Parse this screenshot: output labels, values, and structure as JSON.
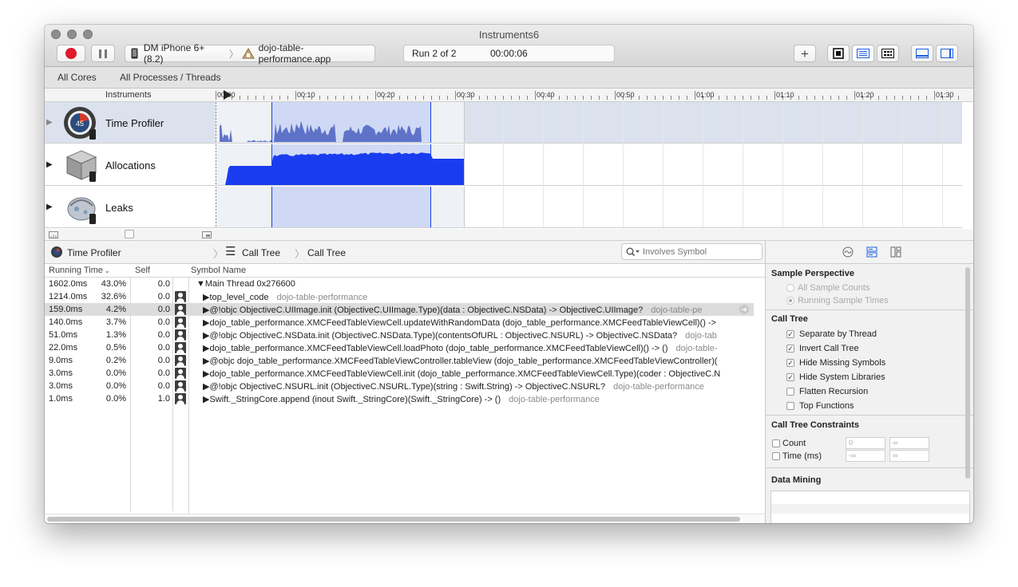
{
  "window": {
    "title": "Instruments6"
  },
  "toolbar": {
    "device": "DM iPhone 6+ (8.2)",
    "app": "dojo-table-performance.app",
    "run_label": "Run 2 of 2",
    "elapsed": "00:00:06"
  },
  "scope": {
    "cores": "All Cores",
    "processes": "All Processes / Threads"
  },
  "timeline": {
    "header": "Instruments",
    "ticks": [
      "00:00",
      "00:10",
      "00:20",
      "00:30",
      "00:40",
      "00:50",
      "01:00",
      "01:10",
      "01:20",
      "01:30"
    ],
    "tracks": [
      {
        "name": "Time Profiler",
        "icon": "time-profiler-gauge-icon"
      },
      {
        "name": "Allocations",
        "icon": "allocations-box-icon"
      },
      {
        "name": "Leaks",
        "icon": "leaks-icon"
      }
    ],
    "gauge_text": "45"
  },
  "detail": {
    "instrument": "Time Profiler",
    "breadcrumb1": "Call Tree",
    "breadcrumb2": "Call Tree",
    "search_placeholder": "Involves Symbol",
    "columns": {
      "running": "Running Time",
      "self": "Self",
      "symbol": "Symbol Name"
    },
    "rows": [
      {
        "time": "1602.0ms",
        "pct": "43.0%",
        "self": "0.0",
        "indent": 0,
        "symbol": "▼Main Thread  0x276600",
        "lib": "",
        "user": false
      },
      {
        "time": "1214.0ms",
        "pct": "32.6%",
        "self": "0.0",
        "indent": 1,
        "symbol": "▶top_level_code",
        "lib": "dojo-table-performance",
        "user": true
      },
      {
        "time": "159.0ms",
        "pct": "4.2%",
        "self": "0.0",
        "indent": 1,
        "symbol": "▶@!objc ObjectiveC.UIImage.init (ObjectiveC.UIImage.Type)(data : ObjectiveC.NSData) -> ObjectiveC.UIImage?",
        "lib": "dojo-table-pe",
        "user": true,
        "selected": true
      },
      {
        "time": "140.0ms",
        "pct": "3.7%",
        "self": "0.0",
        "indent": 1,
        "symbol": "▶dojo_table_performance.XMCFeedTableViewCell.updateWithRandomData (dojo_table_performance.XMCFeedTableViewCell)() ->",
        "lib": "",
        "user": true
      },
      {
        "time": "51.0ms",
        "pct": "1.3%",
        "self": "0.0",
        "indent": 1,
        "symbol": "▶@!objc ObjectiveC.NSData.init (ObjectiveC.NSData.Type)(contentsOfURL : ObjectiveC.NSURL) -> ObjectiveC.NSData?",
        "lib": "dojo-tab",
        "user": true
      },
      {
        "time": "22.0ms",
        "pct": "0.5%",
        "self": "0.0",
        "indent": 1,
        "symbol": "▶dojo_table_performance.XMCFeedTableViewCell.loadPhoto (dojo_table_performance.XMCFeedTableViewCell)() -> ()",
        "lib": "dojo-table-",
        "user": true
      },
      {
        "time": "9.0ms",
        "pct": "0.2%",
        "self": "0.0",
        "indent": 1,
        "symbol": "▶@objc dojo_table_performance.XMCFeedTableViewController.tableView (dojo_table_performance.XMCFeedTableViewController)(",
        "lib": "",
        "user": true
      },
      {
        "time": "3.0ms",
        "pct": "0.0%",
        "self": "0.0",
        "indent": 1,
        "symbol": "▶dojo_table_performance.XMCFeedTableViewCell.init (dojo_table_performance.XMCFeedTableViewCell.Type)(coder : ObjectiveC.N",
        "lib": "",
        "user": true
      },
      {
        "time": "3.0ms",
        "pct": "0.0%",
        "self": "0.0",
        "indent": 1,
        "symbol": "▶@!objc ObjectiveC.NSURL.init (ObjectiveC.NSURL.Type)(string : Swift.String) -> ObjectiveC.NSURL?",
        "lib": "dojo-table-performance",
        "user": true
      },
      {
        "time": "1.0ms",
        "pct": "0.0%",
        "self": "1.0",
        "indent": 1,
        "symbol": "▶Swift._StringCore.append (inout Swift._StringCore)(Swift._StringCore) -> ()",
        "lib": "dojo-table-performance",
        "user": true
      }
    ]
  },
  "inspector": {
    "sample_perspective": {
      "title": "Sample Perspective",
      "options": [
        {
          "label": "All Sample Counts",
          "selected": false
        },
        {
          "label": "Running Sample Times",
          "selected": true
        }
      ]
    },
    "call_tree": {
      "title": "Call Tree",
      "options": [
        {
          "label": "Separate by Thread",
          "checked": true
        },
        {
          "label": "Invert Call Tree",
          "checked": true
        },
        {
          "label": "Hide Missing Symbols",
          "checked": true
        },
        {
          "label": "Hide System Libraries",
          "checked": true
        },
        {
          "label": "Flatten Recursion",
          "checked": false
        },
        {
          "label": "Top Functions",
          "checked": false
        }
      ]
    },
    "constraints": {
      "title": "Call Tree Constraints",
      "count_label": "Count",
      "time_label": "Time (ms)",
      "count_min": "0",
      "count_max": "∞",
      "time_min": "-∞",
      "time_max": "∞"
    },
    "data_mining": {
      "title": "Data Mining"
    }
  },
  "colors": {
    "accent": "#1a3cf0",
    "selection": "#cfd9f5",
    "record": "#e0192b"
  }
}
